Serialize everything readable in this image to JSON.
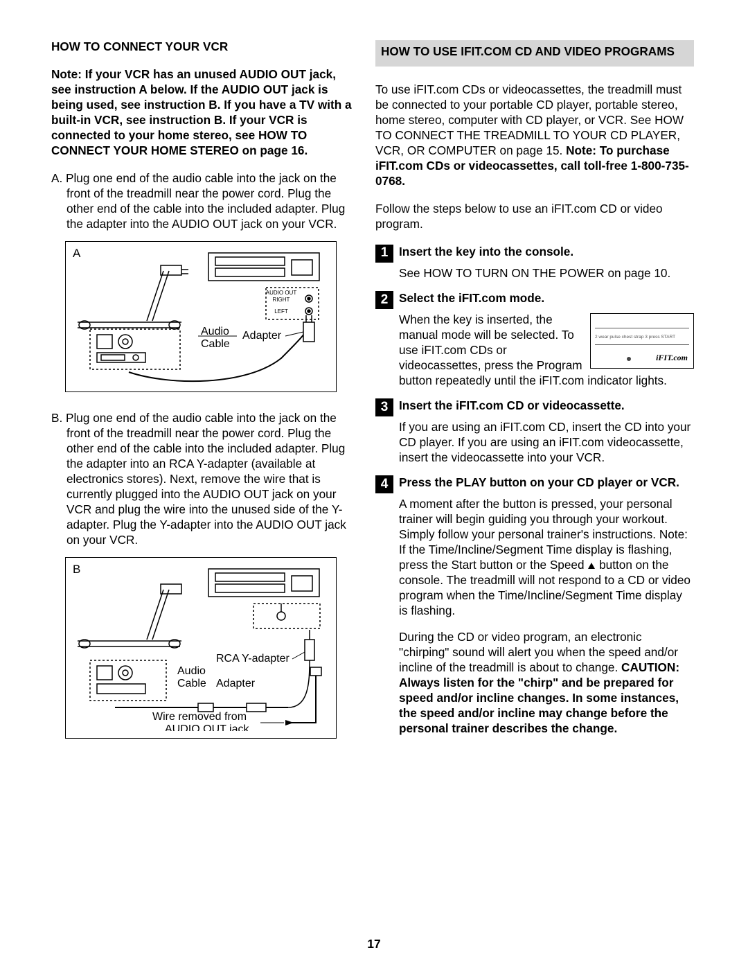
{
  "page_number": "17",
  "left": {
    "title": "HOW TO CONNECT YOUR VCR",
    "note": "Note: If your VCR has an unused AUDIO OUT jack, see instruction A below. If the AUDIO OUT jack is being used, see instruction B. If you have a TV with a built-in VCR, see instruction B. If your VCR is connected to your home stereo, see HOW TO CONNECT YOUR HOME STEREO on page 16.",
    "stepA": "A. Plug one end of the audio cable into the jack on the front of the treadmill near the power cord. Plug the other end of the cable into the included adapter. Plug the adapter into the AUDIO OUT jack on your VCR.",
    "figA": {
      "label": "A",
      "audio_cable": "Audio Cable",
      "adapter": "Adapter",
      "audio_out": "AUDIO OUT",
      "right": "RIGHT",
      "left": "LEFT"
    },
    "stepB": "B. Plug one end of the audio cable into the jack on the front of the treadmill near the power cord. Plug the other end of the cable into the included adapter. Plug the adapter into an RCA Y-adapter (available at electronics stores). Next, remove the wire that is currently plugged into the AUDIO OUT jack on your VCR and plug the wire into the unused side of the Y-adapter. Plug the Y-adapter into the AUDIO OUT jack on your VCR.",
    "figB": {
      "label": "B",
      "audio_cable": "Audio Cable",
      "adapter": "Adapter",
      "rca": "RCA Y-adapter",
      "wire_removed": "Wire removed from AUDIO OUT jack"
    }
  },
  "right": {
    "title": "HOW TO USE IFIT.COM CD AND VIDEO PROGRAMS",
    "intro_pre": "To use iFIT.com CDs or videocassettes, the treadmill must be connected to your portable CD player, portable stereo, home stereo, computer with CD player, or VCR. See HOW TO CONNECT THE TREADMILL TO YOUR CD PLAYER, VCR, OR COMPUTER on page 15. ",
    "intro_bold": "Note: To purchase iFIT.com CDs or videocassettes, call toll-free 1-800-735-0768.",
    "follow": "Follow the steps below to use an iFIT.com CD or video program.",
    "steps": [
      {
        "n": "1",
        "title": "Insert the key into the console.",
        "body": "See HOW TO TURN ON THE POWER on page 10."
      },
      {
        "n": "2",
        "title": "Select the iFIT.com mode.",
        "body": "When the key is inserted, the manual mode will be selected. To use iFIT.com CDs or videocassettes, press the Program button repeatedly until the iFIT.com indicator lights."
      },
      {
        "n": "3",
        "title": "Insert the iFIT.com CD or videocassette.",
        "body": "If you are using an iFIT.com CD, insert the CD into your CD player. If you are using an iFIT.com videocassette, insert the videocassette into your VCR."
      },
      {
        "n": "4",
        "title": "Press the PLAY button on your CD player or VCR.",
        "body_a_pre": "A moment after the button is pressed, your personal trainer will begin guiding you through your workout. Simply follow your personal trainer's instructions. Note: If the Time/Incline/Segment Time display is flashing, press the Start button or the Speed ",
        "body_a_post": " button on the console. The treadmill will not respond to a CD or video program when the Time/Incline/Segment Time display is flashing.",
        "body_b_pre": "During the CD or video program, an electronic \"chirping\" sound will alert you when the speed and/or incline of the treadmill is about to change. ",
        "body_b_bold": "CAUTION: Always listen for the \"chirp\" and be prepared for speed and/or incline changes. In some instances, the speed and/or incline may change before the personal trainer describes the change."
      }
    ],
    "console_labels": {
      "line2": "2  wear pulse chest strap  3  press START",
      "ifit": "iFIT.com"
    }
  }
}
